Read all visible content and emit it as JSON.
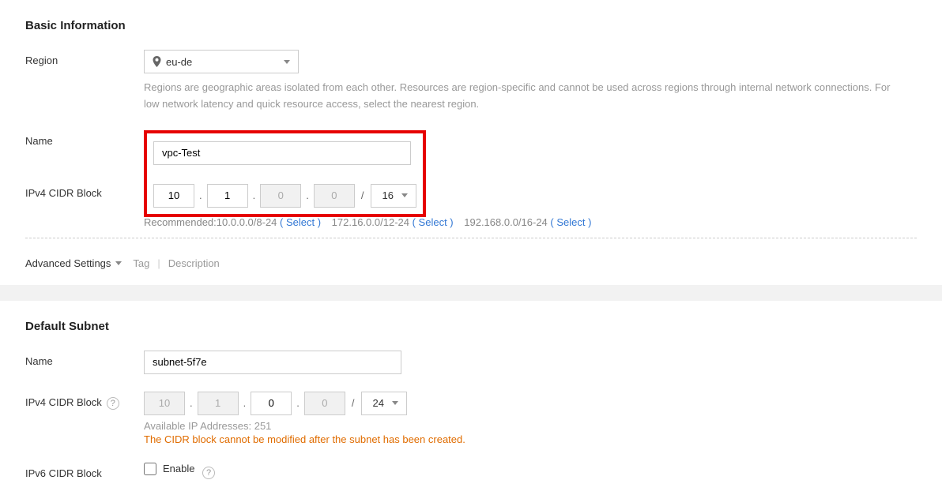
{
  "basic": {
    "heading": "Basic Information",
    "region_label": "Region",
    "region_value": "eu-de",
    "region_help": "Regions are geographic areas isolated from each other. Resources are region-specific and cannot be used across regions through internal network connections. For low network latency and quick resource access, select the nearest region.",
    "name_label": "Name",
    "name_value": "vpc-Test",
    "cidr_label": "IPv4 CIDR Block",
    "cidr": {
      "o1": "10",
      "o2": "1",
      "o3": "0",
      "o4": "0",
      "prefix": "16"
    },
    "recommend_label": "Recommended:",
    "recommend_options": [
      {
        "range": "10.0.0.0/8-24",
        "select": "( Select )"
      },
      {
        "range": "172.16.0.0/12-24",
        "select": "( Select )"
      },
      {
        "range": "192.168.0.0/16-24",
        "select": "( Select )"
      }
    ],
    "advanced_label": "Advanced Settings",
    "adv_tag": "Tag",
    "adv_desc": "Description"
  },
  "subnet": {
    "heading": "Default Subnet",
    "name_label": "Name",
    "name_value": "subnet-5f7e",
    "cidr_label": "IPv4 CIDR Block",
    "cidr": {
      "o1": "10",
      "o2": "1",
      "o3": "0",
      "o4": "0",
      "prefix": "24"
    },
    "available": "Available IP Addresses: 251",
    "warning": "The CIDR block cannot be modified after the subnet has been created.",
    "ipv6_label": "IPv6 CIDR Block",
    "ipv6_enable": "Enable"
  }
}
